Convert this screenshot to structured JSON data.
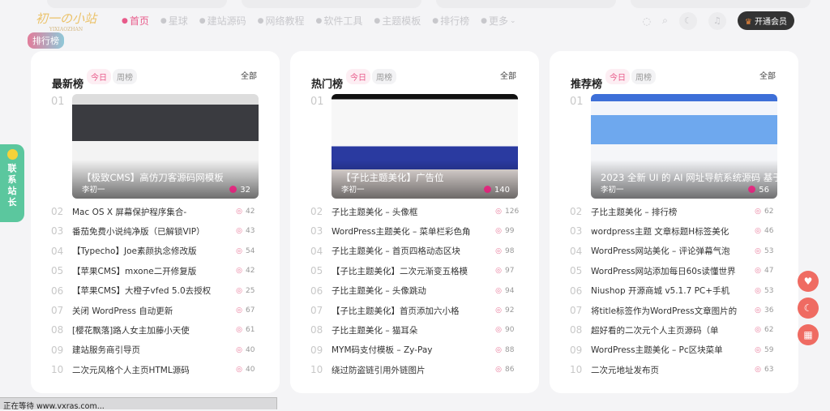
{
  "header": {
    "logo_text": "初一の小站",
    "logo_sub": "YIXIAOZHAN",
    "nav": [
      {
        "label": "首页",
        "active": true,
        "icon": "home-icon"
      },
      {
        "label": "星球",
        "icon": "planet-icon"
      },
      {
        "label": "建站源码",
        "icon": "code-icon"
      },
      {
        "label": "网络教程",
        "icon": "book-icon"
      },
      {
        "label": "软件工具",
        "icon": "tool-icon"
      },
      {
        "label": "主题模板",
        "icon": "theme-icon"
      },
      {
        "label": "排行榜",
        "icon": "trophy-icon"
      },
      {
        "label": "更多",
        "icon": "more-icon"
      }
    ],
    "vip_label": "开通会员",
    "rank_tag": "排行榜"
  },
  "contact": {
    "label": "联系站长"
  },
  "status_text": "正在等待 www.vxras.com...",
  "colors": {
    "accent": "#e85a8a",
    "contact": "#5bc79e",
    "fab": "#ef6b62"
  },
  "boards": [
    {
      "title": "最新榜",
      "tab_today": "今日",
      "tab_week": "周榜",
      "all": "全部",
      "top": {
        "num": "01",
        "title": "【极致CMS】高仿刀客源码网模板",
        "author": "李初一",
        "views": "32"
      },
      "items": [
        {
          "num": "02",
          "title": "Mac OS X 屏幕保护程序集合-",
          "views": "42"
        },
        {
          "num": "03",
          "title": "番茄免费小说纯净版（已解锁VIP）",
          "views": "43"
        },
        {
          "num": "04",
          "title": "【Typecho】Joe素颜执念修改版",
          "views": "54"
        },
        {
          "num": "05",
          "title": "【苹果CMS】mxone二开修复版",
          "views": "42"
        },
        {
          "num": "06",
          "title": "【苹果CMS】大橙子vfed 5.0去授权",
          "views": "25"
        },
        {
          "num": "07",
          "title": "关闭 WordPress 自动更新",
          "views": "67"
        },
        {
          "num": "08",
          "title": "[樱花飘落]路人女主加藤小天使",
          "views": "61"
        },
        {
          "num": "09",
          "title": "建站服务商引导页",
          "views": "40"
        },
        {
          "num": "10",
          "title": "二次元风格个人主页HTML源码",
          "views": "40"
        }
      ]
    },
    {
      "title": "热门榜",
      "tab_today": "今日",
      "tab_week": "周榜",
      "all": "全部",
      "top": {
        "num": "01",
        "title": "【子比主题美化】广告位",
        "author": "李初一",
        "views": "140"
      },
      "items": [
        {
          "num": "02",
          "title": "子比主题美化 – 头像框",
          "views": "126"
        },
        {
          "num": "03",
          "title": "WordPress主题美化 – 菜单栏彩色角",
          "views": "99"
        },
        {
          "num": "04",
          "title": "子比主题美化 – 首页四格动态区块",
          "views": "98"
        },
        {
          "num": "05",
          "title": "【子比主题美化】二次元渐变五格模",
          "views": "97"
        },
        {
          "num": "06",
          "title": "子比主题美化 – 头像跳动",
          "views": "94"
        },
        {
          "num": "07",
          "title": "【子比主题美化】首页添加六小格",
          "views": "92"
        },
        {
          "num": "08",
          "title": "子比主题美化 – 猫耳朵",
          "views": "90"
        },
        {
          "num": "09",
          "title": "MYM码支付模板 – Zy-Pay",
          "views": "88"
        },
        {
          "num": "10",
          "title": "绕过防盗链引用外链图片",
          "views": "86"
        }
      ]
    },
    {
      "title": "推荐榜",
      "tab_today": "今日",
      "tab_week": "周榜",
      "all": "全部",
      "top": {
        "num": "01",
        "title": "2023 全新 UI 的 AI 网址导航系统源码 基于",
        "author": "李初一",
        "views": "56"
      },
      "items": [
        {
          "num": "02",
          "title": "子比主题美化 – 排行榜",
          "views": "62"
        },
        {
          "num": "03",
          "title": "wordpress主题 文章标题H标签美化",
          "views": "46"
        },
        {
          "num": "04",
          "title": "WordPress网站美化 – 评论弹幕气泡",
          "views": "53"
        },
        {
          "num": "05",
          "title": "WordPress网站添加每日60s读懂世界",
          "views": "47"
        },
        {
          "num": "06",
          "title": "Niushop 开源商城 v5.1.7 PC+手机",
          "views": "53"
        },
        {
          "num": "07",
          "title": "将title标签作为WordPress文章图片的",
          "views": "36"
        },
        {
          "num": "08",
          "title": "超好看的二次元个人主页源码（单",
          "views": "62"
        },
        {
          "num": "09",
          "title": "WordPress主题美化 – Pc区块菜单",
          "views": "59"
        },
        {
          "num": "10",
          "title": "二次元地址发布页",
          "views": "63"
        }
      ]
    }
  ]
}
